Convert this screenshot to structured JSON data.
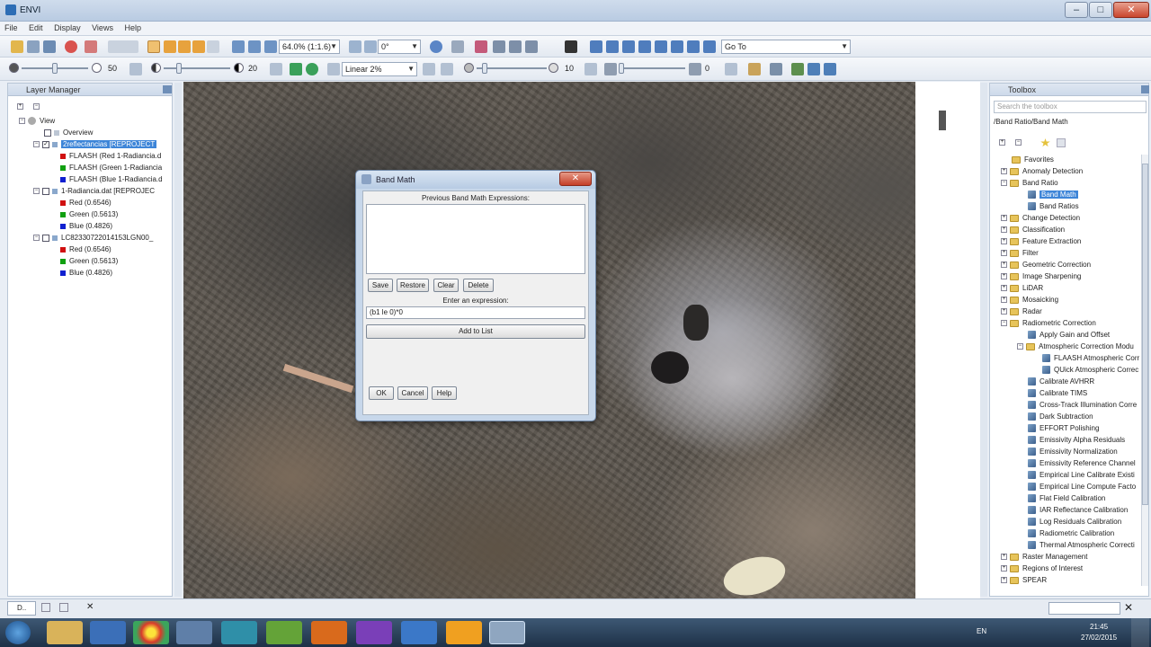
{
  "window": {
    "title": "ENVI",
    "min": "–",
    "max": "□",
    "close": "✕"
  },
  "menu": [
    "File",
    "Edit",
    "Display",
    "Views",
    "Help"
  ],
  "toolbar1": {
    "zoom": "64.0% (1:1.6)",
    "rotation": "0°",
    "goto": "Go To"
  },
  "toolbar2": {
    "brightness": "50",
    "contrast": "20",
    "stretch": "Linear 2%",
    "sharpen": "10",
    "transparency": "0"
  },
  "layer_manager": {
    "title": "Layer Manager",
    "items": [
      "View",
      "Overview",
      "2reflectancias [REPROJECT",
      "FLAASH (Red 1-Radiancia.d",
      "FLAASH (Green 1-Radiancia",
      "FLAASH (Blue 1-Radiancia.d",
      "1-Radiancia.dat [REPROJEC",
      "Red (0.6546)",
      "Green (0.5613)",
      "Blue (0.4826)",
      "LC82330722014153LGN00_",
      "Red (0.6546)",
      "Green (0.5613)",
      "Blue (0.4826)"
    ]
  },
  "toolbox": {
    "title": "Toolbox",
    "search_placeholder": "Search the toolbox",
    "path": "/Band Ratio/Band Math",
    "items": [
      "Favorites",
      "Anomaly Detection",
      "Band Ratio",
      "Band Math",
      "Band Ratios",
      "Change Detection",
      "Classification",
      "Feature Extraction",
      "Filter",
      "Geometric Correction",
      "Image Sharpening",
      "LiDAR",
      "Mosaicking",
      "Radar",
      "Radiometric Correction",
      "Apply Gain and Offset",
      "Atmospheric Correction Modu",
      "FLAASH Atmospheric Corr",
      "QUick Atmospheric Correc",
      "Calibrate AVHRR",
      "Calibrate TIMS",
      "Cross-Track Illumination Corre",
      "Dark Subtraction",
      "EFFORT Polishing",
      "Emissivity Alpha Residuals",
      "Emissivity Normalization",
      "Emissivity Reference Channel",
      "Empirical Line Calibrate Existi",
      "Empirical Line Compute Facto",
      "Flat Field Calibration",
      "IAR Reflectance Calibration",
      "Log Residuals Calibration",
      "Radiometric Calibration",
      "Thermal Atmospheric Correcti",
      "Raster Management",
      "Regions of Interest",
      "SPEAR"
    ]
  },
  "band_math": {
    "title": "Band Math",
    "previous_label": "Previous Band Math Expressions:",
    "save": "Save",
    "restore": "Restore",
    "clear": "Clear",
    "delete": "Delete",
    "enter_label": "Enter an expression:",
    "expression": "(b1 le 0)*0",
    "add_to_list": "Add to List",
    "ok": "OK",
    "cancel": "Cancel",
    "help": "Help"
  },
  "status": {
    "tab": "D..",
    "close": "✕"
  },
  "taskbar": {
    "lang": "EN",
    "time": "21:45",
    "date": "27/02/2015"
  },
  "colors": {
    "selection": "#3d85d8",
    "title_gradient": "#b9cbe2",
    "taskbar": "#1e3147"
  }
}
